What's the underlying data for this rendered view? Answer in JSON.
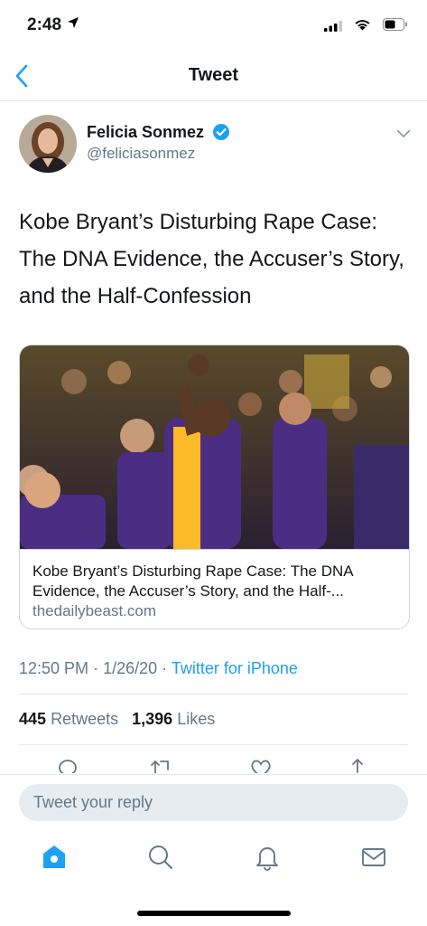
{
  "status_bar": {
    "time": "2:48"
  },
  "nav": {
    "title": "Tweet"
  },
  "tweet": {
    "author_name": "Felicia Sonmez",
    "author_handle": "@feliciasonmez",
    "text": "Kobe Bryant’s Disturbing Rape Case: The DNA Evidence, the Accuser’s Story, and the Half-Confession",
    "card": {
      "title": "Kobe Bryant’s Disturbing Rape Case: The DNA Evidence, the Accuser’s Story, and the Half-...",
      "domain": "thedailybeast.com"
    },
    "time": "12:50 PM",
    "date": "1/26/20",
    "sep": "·",
    "source": "Twitter for iPhone",
    "retweets": "445",
    "retweets_label": "Retweets",
    "likes": "1,396",
    "likes_label": "Likes"
  },
  "reply": {
    "placeholder": "Tweet your reply"
  },
  "colors": {
    "accent": "#1da1f2",
    "text": "#14171a",
    "secondary": "#657786",
    "border": "#e1e8ed"
  },
  "icons": {
    "back": "chevron-left-icon",
    "verified": "verified-badge-icon",
    "menu": "chevron-down-icon",
    "actions": [
      "reply-icon",
      "retweet-icon",
      "like-icon",
      "share-icon"
    ],
    "tabs": [
      "home-icon",
      "search-icon",
      "notifications-icon",
      "messages-icon"
    ]
  }
}
